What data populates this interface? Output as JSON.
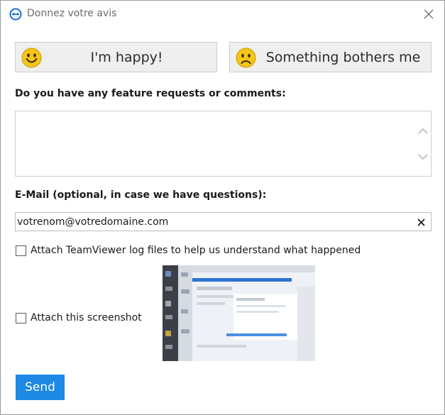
{
  "window": {
    "title": "Donnez votre avis"
  },
  "mood": {
    "happy_label": "I'm happy!",
    "bothers_label": "Something bothers me"
  },
  "comments": {
    "label": "Do you have any feature requests or comments:",
    "value": ""
  },
  "email": {
    "label": "E-Mail (optional, in case we have questions):",
    "value": "votrenom@votredomaine.com"
  },
  "attachments": {
    "log_files_label": "Attach TeamViewer log files to help us understand what happened",
    "log_files_checked": false,
    "screenshot_label": "Attach this screenshot",
    "screenshot_checked": false
  },
  "actions": {
    "send_label": "Send"
  },
  "colors": {
    "accent": "#1e88e5",
    "smiley": "#f5c518",
    "button_bg": "#efefef"
  },
  "icons": {
    "app": "teamviewer-logo-icon",
    "close": "close-icon",
    "happy": "smiley-happy-icon",
    "sad": "smiley-sad-icon",
    "clear": "clear-icon"
  }
}
